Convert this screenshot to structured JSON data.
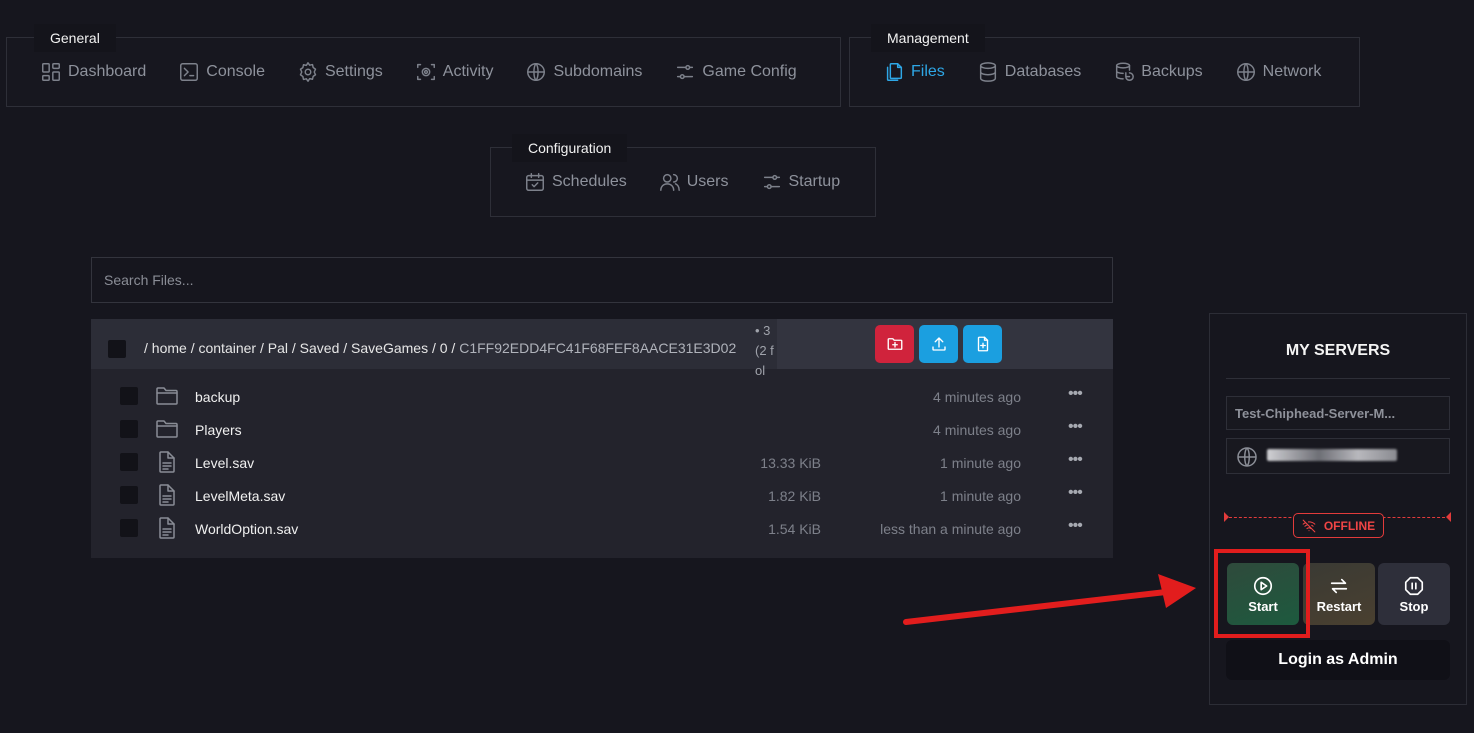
{
  "nav": {
    "general": {
      "title": "General",
      "items": [
        {
          "label": "Dashboard",
          "icon": "dashboard-icon"
        },
        {
          "label": "Console",
          "icon": "console-icon"
        },
        {
          "label": "Settings",
          "icon": "gear-icon"
        },
        {
          "label": "Activity",
          "icon": "activity-icon"
        },
        {
          "label": "Subdomains",
          "icon": "globe-icon"
        },
        {
          "label": "Game Config",
          "icon": "sliders-icon"
        }
      ]
    },
    "management": {
      "title": "Management",
      "items": [
        {
          "label": "Files",
          "icon": "files-icon",
          "active": true
        },
        {
          "label": "Databases",
          "icon": "database-icon"
        },
        {
          "label": "Backups",
          "icon": "backup-icon"
        },
        {
          "label": "Network",
          "icon": "globe-icon"
        }
      ]
    },
    "configuration": {
      "title": "Configuration",
      "items": [
        {
          "label": "Schedules",
          "icon": "calendar-icon"
        },
        {
          "label": "Users",
          "icon": "users-icon"
        },
        {
          "label": "Startup",
          "icon": "sliders-icon"
        }
      ]
    }
  },
  "search": {
    "placeholder": "Search Files..."
  },
  "files": {
    "path": {
      "segments": [
        "home",
        "container",
        "Pal",
        "Saved",
        "SaveGames",
        "0"
      ],
      "last": "C1FF92EDD4FC41F68FEF8AACE31E3D02",
      "count": "• 3 (2 fol"
    },
    "rows": [
      {
        "name": "backup",
        "type": "folder",
        "size": "",
        "modified": "4 minutes ago"
      },
      {
        "name": "Players",
        "type": "folder",
        "size": "",
        "modified": "4 minutes ago"
      },
      {
        "name": "Level.sav",
        "type": "file",
        "size": "13.33 KiB",
        "modified": "1 minute ago"
      },
      {
        "name": "LevelMeta.sav",
        "type": "file",
        "size": "1.82 KiB",
        "modified": "1 minute ago"
      },
      {
        "name": "WorldOption.sav",
        "type": "file",
        "size": "1.54 KiB",
        "modified": "less than a minute ago"
      }
    ],
    "row_menu": "•••"
  },
  "server_panel": {
    "title": "MY SERVERS",
    "server_name": "Test-Chiphead-Server-M...",
    "status": "OFFLINE",
    "buttons": {
      "start": "Start",
      "restart": "Restart",
      "stop": "Stop"
    },
    "login": "Login as Admin"
  },
  "colors": {
    "accent": "#2ea7e6",
    "danger": "#d0233c",
    "offline": "#e23b3b",
    "highlight": "#e21d1d"
  }
}
